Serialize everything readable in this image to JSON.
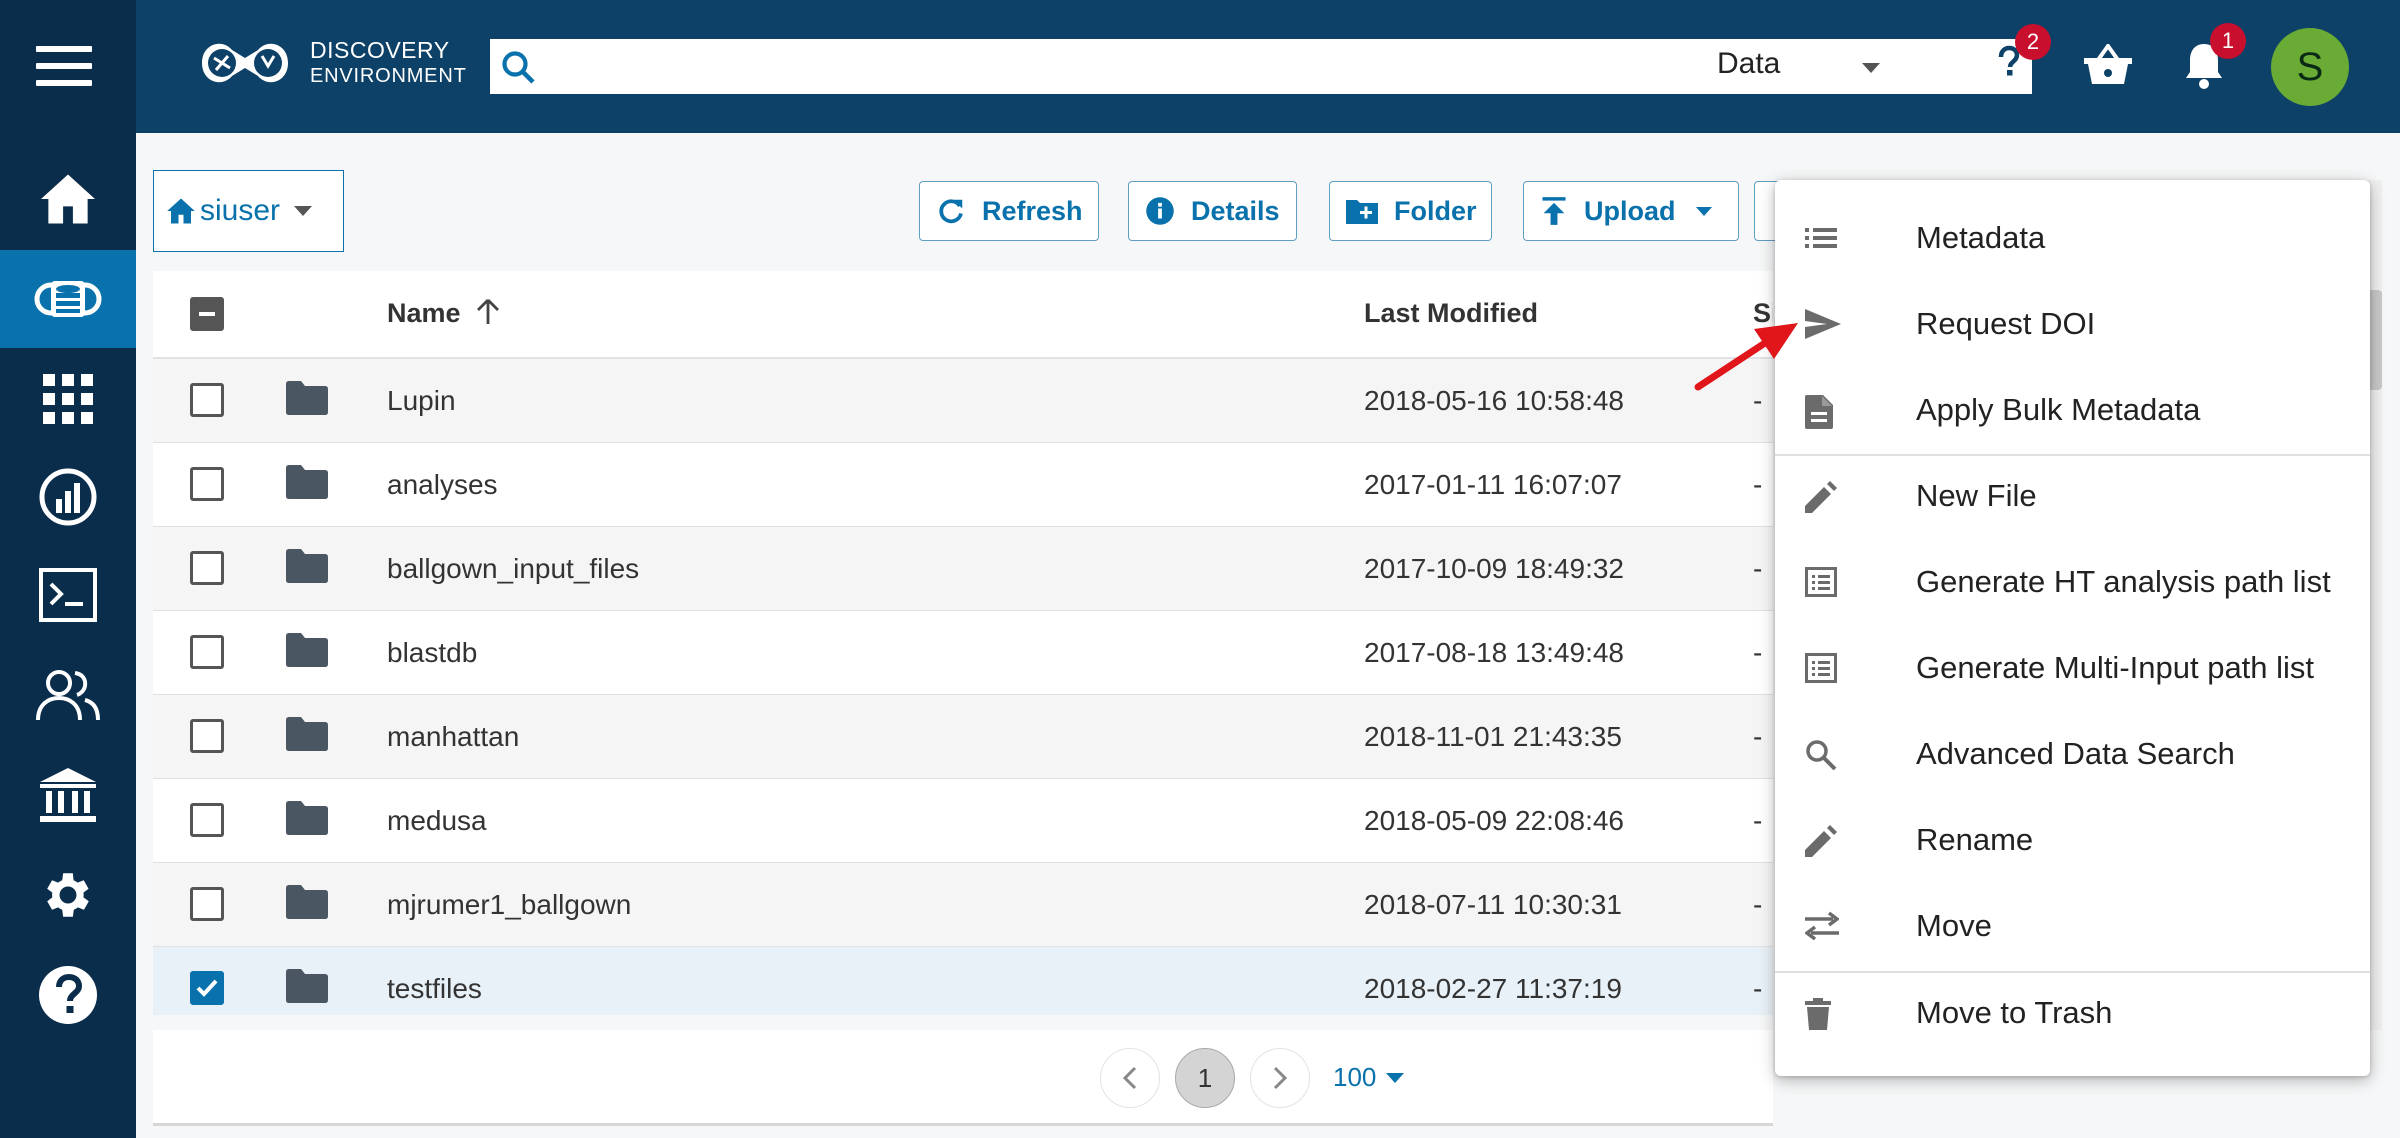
{
  "app": {
    "logo_line1": "DISCOVERY",
    "logo_line2": "ENVIRONMENT",
    "search_type": "Data",
    "help_badge": "2",
    "notifications_badge": "1",
    "avatar_initial": "S"
  },
  "sidebar": {
    "items": [
      {
        "icon": "home-icon"
      },
      {
        "icon": "data-icon",
        "active": true
      },
      {
        "icon": "apps-icon"
      },
      {
        "icon": "analyses-icon"
      },
      {
        "icon": "vice-terminal-icon"
      },
      {
        "icon": "teams-icon"
      },
      {
        "icon": "collections-icon"
      },
      {
        "icon": "settings-icon"
      },
      {
        "icon": "help-icon"
      }
    ]
  },
  "toolbar": {
    "home_label": "siuser",
    "refresh_label": "Refresh",
    "details_label": "Details",
    "folder_label": "Folder",
    "upload_label": "Upload"
  },
  "table": {
    "headers": {
      "name": "Name",
      "last_modified": "Last Modified",
      "size": "Si"
    },
    "rows": [
      {
        "name": "Lupin",
        "modified": "2018-05-16 10:58:48",
        "size": "-",
        "checked": false
      },
      {
        "name": "analyses",
        "modified": "2017-01-11 16:07:07",
        "size": "-",
        "checked": false
      },
      {
        "name": "ballgown_input_files",
        "modified": "2017-10-09 18:49:32",
        "size": "-",
        "checked": false
      },
      {
        "name": "blastdb",
        "modified": "2017-08-18 13:49:48",
        "size": "-",
        "checked": false
      },
      {
        "name": "manhattan",
        "modified": "2018-11-01 21:43:35",
        "size": "-",
        "checked": false
      },
      {
        "name": "medusa",
        "modified": "2018-05-09 22:08:46",
        "size": "-",
        "checked": false
      },
      {
        "name": "mjrumer1_ballgown",
        "modified": "2018-07-11 10:30:31",
        "size": "-",
        "checked": false
      },
      {
        "name": "testfiles",
        "modified": "2018-02-27 11:37:19",
        "size": "-",
        "checked": true
      }
    ]
  },
  "pagination": {
    "page": "1",
    "page_size": "100"
  },
  "menu": {
    "items": [
      {
        "label": "Metadata",
        "icon": "list-icon"
      },
      {
        "label": "Request DOI",
        "icon": "send-icon"
      },
      {
        "label": "Apply Bulk Metadata",
        "icon": "document-icon"
      },
      {
        "label": "New File",
        "icon": "pencil-icon"
      },
      {
        "label": "Generate HT analysis path list",
        "icon": "list-box-icon"
      },
      {
        "label": "Generate Multi-Input path list",
        "icon": "list-box-icon"
      },
      {
        "label": "Advanced Data Search",
        "icon": "search-icon"
      },
      {
        "label": "Rename",
        "icon": "pencil-icon"
      },
      {
        "label": "Move",
        "icon": "swap-icon"
      },
      {
        "label": "Move to Trash",
        "icon": "trash-icon"
      }
    ]
  },
  "colors": {
    "sidebar": "#0a2d4c",
    "topbar": "#0d4167",
    "accent": "#0971ab",
    "badge": "#c8102e",
    "avatar": "#6aab35",
    "arrow": "#e0161b"
  }
}
